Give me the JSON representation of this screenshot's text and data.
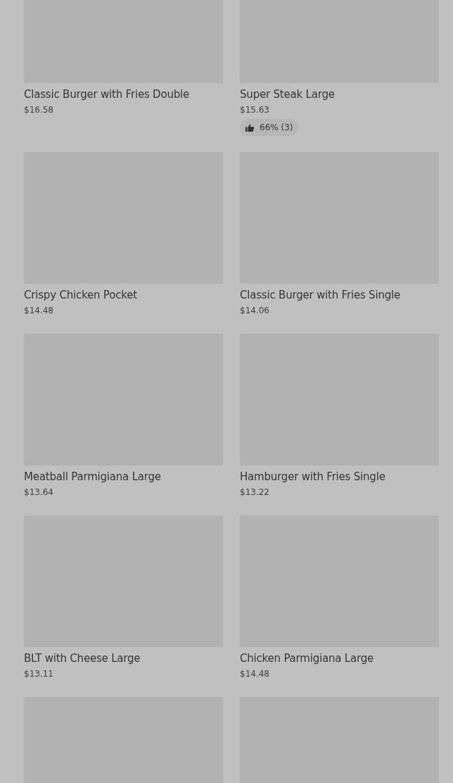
{
  "items": [
    {
      "name": "Classic Burger with Fries Double",
      "price": "$16.58"
    },
    {
      "name": "Super Steak Large",
      "price": "$15.63",
      "rating": "66% (3)"
    },
    {
      "name": "Crispy Chicken Pocket",
      "price": "$14.48"
    },
    {
      "name": "Classic Burger with Fries Single",
      "price": "$14.06"
    },
    {
      "name": "Meatball Parmigiana Large",
      "price": "$13.64"
    },
    {
      "name": "Hamburger with Fries Single",
      "price": "$13.22"
    },
    {
      "name": "BLT with Cheese Large",
      "price": "$13.11"
    },
    {
      "name": "Chicken Parmigiana Large",
      "price": "$14.48"
    },
    {
      "kind": "picture"
    },
    {
      "kind": "picture"
    }
  ]
}
